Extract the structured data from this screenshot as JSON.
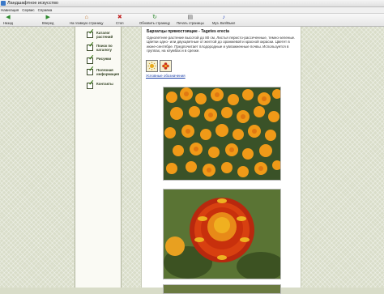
{
  "window": {
    "title": "Ландшафтное искусство"
  },
  "menu": {
    "items": [
      "Навигация",
      "Сервис",
      "Справка"
    ]
  },
  "toolbar": {
    "buttons": [
      {
        "label": "Назад",
        "icon": "back-arrow-icon",
        "color": "#2f8a2f"
      },
      {
        "label": "Вперед",
        "icon": "forward-arrow-icon",
        "color": "#2f8a2f"
      },
      {
        "label": "На главную страницу",
        "icon": "home-icon",
        "color": "#c06a1a"
      },
      {
        "label": "Стоп",
        "icon": "stop-icon",
        "color": "#c02020"
      },
      {
        "label": "Обновить страницу",
        "icon": "refresh-icon",
        "color": "#2f8a2f"
      },
      {
        "label": "Печать страницы",
        "icon": "print-icon",
        "color": "#555555"
      },
      {
        "label": "Муз. Вкл/Выкл",
        "icon": "music-icon",
        "color": "#2a4cc0"
      }
    ]
  },
  "sidebar": {
    "items": [
      {
        "label": "Каталог растений"
      },
      {
        "label": "Поиск по каталогу"
      },
      {
        "label": "Рисунки"
      },
      {
        "label": "Полезная информация"
      },
      {
        "label": "Контакты"
      }
    ]
  },
  "content": {
    "title": "Бархатцы прямостоящие - Tagetes erecta",
    "description": "Однолетнее растение высотой до 80 см. Листья перисто-рассеченные, темно-зеленые. Цветки одно- или двухцветные от желтой до оранжевой и красной окраски. Цветет в июне-сентябре. Предпочитает плодородные и увлажненные почвы. Используется в группах, на клумбах и в срезке.",
    "legend_link": "Условные обозначения",
    "thumbs": [
      "sun-icon",
      "flower-icon"
    ],
    "photos": [
      "marigold-bed-photo",
      "marigold-flower-closeup-photo",
      "marigold-photo-3"
    ]
  },
  "colors": {
    "accent": "#3d7a1c",
    "link": "#1a3fa8",
    "background": "#d9ddc9"
  }
}
